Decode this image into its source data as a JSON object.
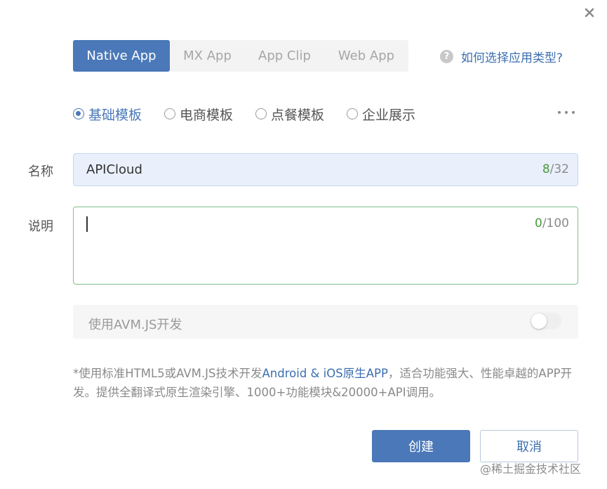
{
  "dialog": {
    "close_icon": "close-icon"
  },
  "tabs": [
    {
      "label": "Native App",
      "active": true
    },
    {
      "label": "MX App",
      "active": false
    },
    {
      "label": "App Clip",
      "active": false
    },
    {
      "label": "Web App",
      "active": false
    }
  ],
  "help": {
    "icon": "question-icon",
    "text": "如何选择应用类型?"
  },
  "templates": [
    {
      "label": "基础模板",
      "checked": true
    },
    {
      "label": "电商模板",
      "checked": false
    },
    {
      "label": "点餐模板",
      "checked": false
    },
    {
      "label": "企业展示",
      "checked": false
    }
  ],
  "more_icon": "more-horizontal-icon",
  "name_field": {
    "label": "名称",
    "value": "APICloud",
    "count": "8",
    "max": "/32"
  },
  "desc_field": {
    "label": "说明",
    "value": "",
    "count": "0",
    "max": "/100"
  },
  "avm": {
    "label": "使用AVM.JS开发",
    "enabled": false
  },
  "description": {
    "part1": "*使用标准HTML5或AVM.JS技术开发",
    "highlight": "Android & iOS原生APP",
    "part2": "，适合功能强大、性能卓越的APP开发。提供全翻译式原生渲染引擎、1000+功能模块&20000+API调用。"
  },
  "buttons": {
    "create": "创建",
    "cancel": "取消"
  },
  "watermark": "@稀土掘金技术社区",
  "colors": {
    "primary": "#4a78b8",
    "link": "#3c6fb0",
    "counter_green": "#4a9a3c",
    "focus_border": "#7cc08e"
  }
}
